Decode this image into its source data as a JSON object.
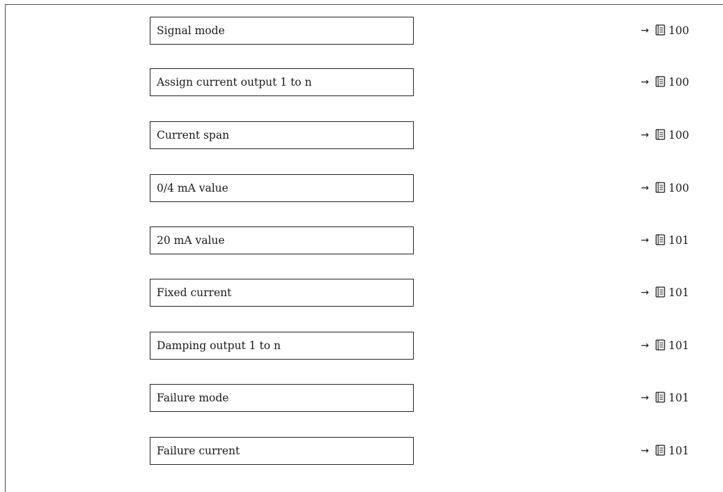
{
  "parameters": [
    {
      "label": "Signal mode",
      "page": "100"
    },
    {
      "label": "Assign current output 1 to n",
      "page": "100"
    },
    {
      "label": "Current span",
      "page": "100"
    },
    {
      "label": "0/4 mA value",
      "page": "100"
    },
    {
      "label": "20 mA value",
      "page": "101"
    },
    {
      "label": "Fixed current",
      "page": "101"
    },
    {
      "label": "Damping output 1 to n",
      "page": "101"
    },
    {
      "label": "Failure mode",
      "page": "101"
    },
    {
      "label": "Failure current",
      "page": "101"
    }
  ],
  "icons": {
    "arrow": "arrow-right-icon",
    "reference": "page-reference-book-icon"
  }
}
